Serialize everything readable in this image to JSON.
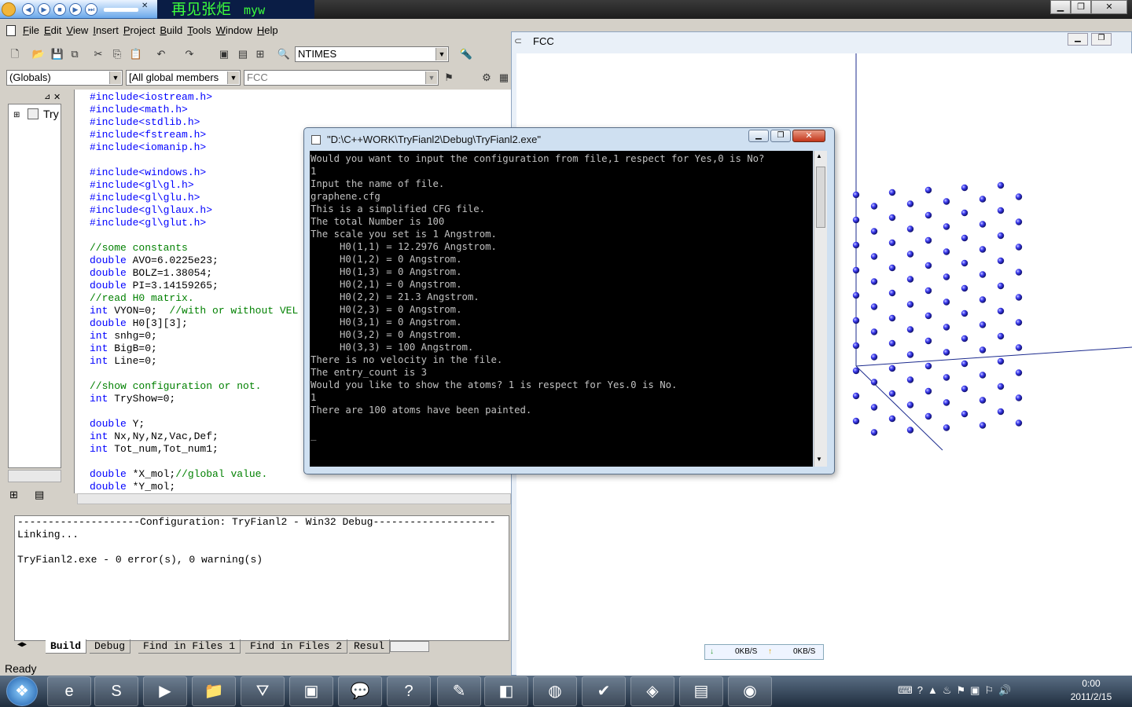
{
  "topbar": {
    "media_title": "再见张炬",
    "media_subtitle": "myw",
    "media_buttons": [
      "prev-icon",
      "play-icon",
      "stop-icon",
      "next-icon",
      "skip-icon"
    ]
  },
  "ide": {
    "menu": [
      {
        "mnemonic": "F",
        "rest": "ile"
      },
      {
        "mnemonic": "E",
        "rest": "dit"
      },
      {
        "mnemonic": "V",
        "rest": "iew"
      },
      {
        "mnemonic": "I",
        "rest": "nsert"
      },
      {
        "mnemonic": "P",
        "rest": "roject"
      },
      {
        "mnemonic": "B",
        "rest": "uild"
      },
      {
        "mnemonic": "T",
        "rest": "ools"
      },
      {
        "mnemonic": "W",
        "rest": "indow"
      },
      {
        "mnemonic": "H",
        "rest": "elp"
      }
    ],
    "find_combo": "NTIMES",
    "globals_combo": "(Globals)",
    "members_combo": "[All global members",
    "function_combo": "FCC",
    "tree_root": "Try",
    "code_lines": [
      {
        "t": "#include<iostream.h>",
        "c": "kw"
      },
      {
        "t": "#include<math.h>",
        "c": "kw"
      },
      {
        "t": "#include<stdlib.h>",
        "c": "kw"
      },
      {
        "t": "#include<fstream.h>",
        "c": "kw"
      },
      {
        "t": "#include<iomanip.h>",
        "c": "kw"
      },
      {
        "t": "",
        "c": ""
      },
      {
        "t": "#include<windows.h>",
        "c": "kw"
      },
      {
        "t": "#include<gl\\gl.h>",
        "c": "kw"
      },
      {
        "t": "#include<gl\\glu.h>",
        "c": "kw"
      },
      {
        "t": "#include<gl\\glaux.h>",
        "c": "kw"
      },
      {
        "t": "#include<gl\\glut.h>",
        "c": "kw"
      },
      {
        "t": "",
        "c": ""
      },
      {
        "t": "//some constants",
        "c": "cm"
      },
      {
        "k": "double",
        "r": " AVO=6.0225e23;"
      },
      {
        "k": "double",
        "r": " BOLZ=1.38054;"
      },
      {
        "k": "double",
        "r": " PI=3.14159265;"
      },
      {
        "t": "//read H0 matrix.",
        "c": "cm"
      },
      {
        "k": "int",
        "r": " VYON=0;  ",
        "cmt": "//with or without VEL"
      },
      {
        "k": "double",
        "r": " H0[3][3];"
      },
      {
        "k": "int",
        "r": " snhg=0;"
      },
      {
        "k": "int",
        "r": " BigB=0;"
      },
      {
        "k": "int",
        "r": " Line=0;"
      },
      {
        "t": "",
        "c": ""
      },
      {
        "t": "//show configuration or not.",
        "c": "cm"
      },
      {
        "k": "int",
        "r": " TryShow=0;"
      },
      {
        "t": "",
        "c": ""
      },
      {
        "k": "double",
        "r": " Y;"
      },
      {
        "k": "int",
        "r": " Nx,Ny,Nz,Vac,Def;"
      },
      {
        "k": "int",
        "r": " Tot_num,Tot_num1;"
      },
      {
        "t": "",
        "c": ""
      },
      {
        "k": "double",
        "r": " *X_mol;",
        "cmt": "//global value."
      },
      {
        "k": "double",
        "r": " *Y_mol;"
      }
    ],
    "output_lines": [
      "--------------------Configuration: TryFianl2 - Win32 Debug--------------------",
      "Linking...",
      "",
      "TryFianl2.exe - 0 error(s), 0 warning(s)"
    ],
    "output_tabs": [
      "Build",
      "Debug",
      "Find in Files 1",
      "Find in Files 2",
      "Resul"
    ],
    "status": "Ready"
  },
  "fcc": {
    "title": "FCC",
    "net_down": "0KB/S",
    "net_up": "0KB/S"
  },
  "console": {
    "title": "\"D:\\C++WORK\\TryFianl2\\Debug\\TryFianl2.exe\"",
    "lines": [
      "Would you want to input the configuration from file,1 respect for Yes,0 is No?",
      "1",
      "Input the name of file.",
      "graphene.cfg",
      "This is a simplified CFG file.",
      "The total Number is 100",
      "The scale you set is 1 Angstrom.",
      "     H0(1,1) = 12.2976 Angstrom.",
      "     H0(1,2) = 0 Angstrom.",
      "     H0(1,3) = 0 Angstrom.",
      "     H0(2,1) = 0 Angstrom.",
      "     H0(2,2) = 21.3 Angstrom.",
      "     H0(2,3) = 0 Angstrom.",
      "     H0(3,1) = 0 Angstrom.",
      "     H0(3,2) = 0 Angstrom.",
      "     H0(3,3) = 100 Angstrom.",
      "There is no velocity in the file.",
      "The entry_count is 3",
      "Would you like to show the atoms? 1 is respect for Yes.0 is No.",
      "1",
      "There are 100 atoms have been painted.",
      "",
      "_"
    ]
  },
  "taskbar": {
    "apps": [
      "start-orb-icon",
      "ie-icon",
      "skype-icon",
      "media-player-icon",
      "explorer-icon",
      "pdf-icon",
      "office-icon",
      "talk-icon",
      "help-icon",
      "paint-icon",
      "notes-icon",
      "swirl-app-icon",
      "nvidia-icon",
      "chart-app-icon",
      "editor-icon",
      "opengl-icon"
    ],
    "time": "0:00",
    "date": "2011/2/15"
  },
  "colors": {
    "atom": "#3b3bf0",
    "axis": "#1c2b8e",
    "console_bg": "#000000"
  }
}
